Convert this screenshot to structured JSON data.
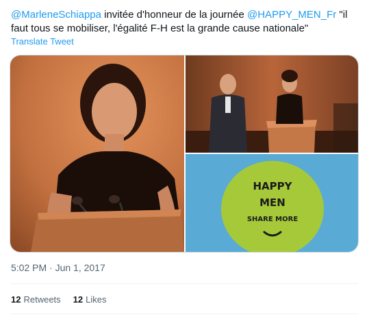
{
  "tweet": {
    "mention_author": "@MarleneSchiappa",
    "text_part1": " invitée d'honneur de la journée ",
    "mention_org": "@HAPPY_MEN_Fr",
    "text_part2": " \"il faut tous se mobiliser, l'égalité F-H est la grande cause nationale\""
  },
  "translate_label": "Translate Tweet",
  "media": {
    "sign_line1": "HAPPY",
    "sign_line2": "MEN",
    "sign_line3": "SHARE MORE",
    "colors": {
      "stage_orange": "#c2703f",
      "sky_blue": "#5aaad6",
      "sign_green": "#a6c93a"
    }
  },
  "timestamp": "5:02 PM · Jun 1, 2017",
  "stats": {
    "retweets_count": "12",
    "retweets_label": "Retweets",
    "likes_count": "12",
    "likes_label": "Likes"
  },
  "colors": {
    "link": "#1d9bf0",
    "secondary_text": "#536471",
    "border": "#cfd9de"
  }
}
